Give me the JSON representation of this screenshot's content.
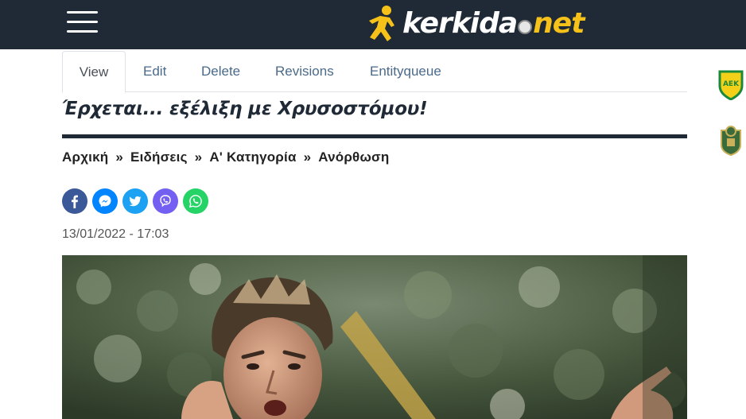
{
  "header": {
    "menu_icon": "hamburger-menu-icon",
    "logo_white": "kerkida",
    "logo_yellow": "net",
    "background": "#1f2a36",
    "accent": "#f6c21a"
  },
  "tabs": [
    {
      "label": "View",
      "active": true
    },
    {
      "label": "Edit"
    },
    {
      "label": "Delete"
    },
    {
      "label": "Revisions"
    },
    {
      "label": "Entityqueue"
    }
  ],
  "article": {
    "headline": "Έρχεται... εξέλιξη με Χρυσοστόμου!",
    "date": "13/01/2022 - 17:03",
    "image_icon": "player-photo"
  },
  "breadcrumb": {
    "items": [
      "Αρχική",
      "Ειδήσεις",
      "Α' Κατηγορία",
      "Ανόρθωση"
    ],
    "separator": "»"
  },
  "share": [
    {
      "icon": "facebook-icon",
      "color": "#3b5998"
    },
    {
      "icon": "messenger-icon",
      "color": "#0084ff"
    },
    {
      "icon": "twitter-icon",
      "color": "#1da1f2"
    },
    {
      "icon": "viber-icon",
      "color": "#7360f2"
    },
    {
      "icon": "whatsapp-icon",
      "color": "#25d366"
    }
  ],
  "sidebar": {
    "badges": [
      "aek-crest-icon",
      "omonia-crest-icon"
    ]
  }
}
